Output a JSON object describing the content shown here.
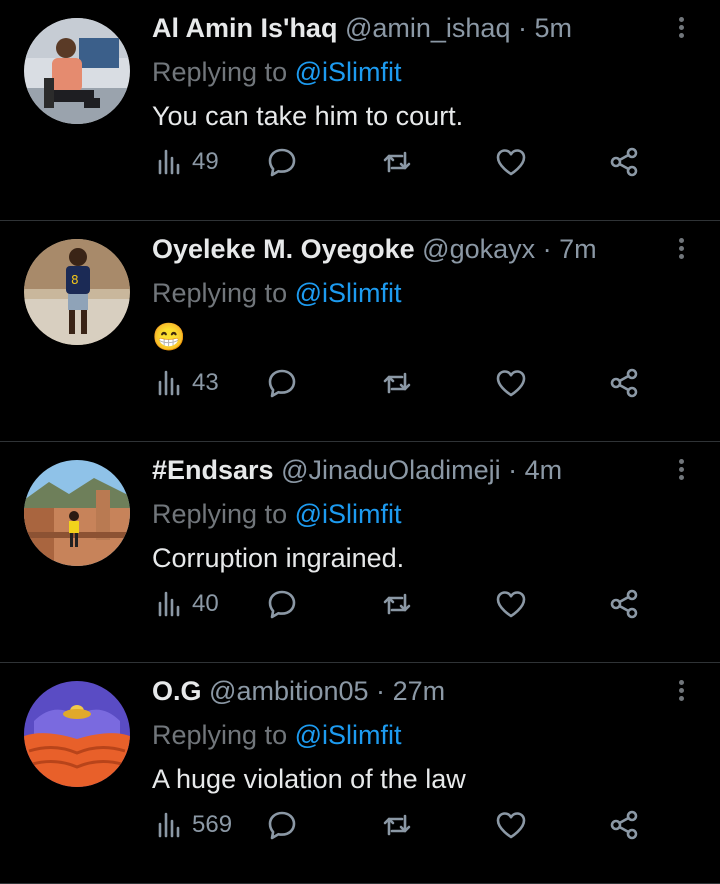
{
  "tweets": [
    {
      "name": "Al Amin Is'haq",
      "handle": "@amin_ishaq",
      "time": "5m",
      "replying_label": "Replying to",
      "mention": "@iSlimfit",
      "text": "You can take him to court.",
      "views": "49"
    },
    {
      "name": "Oyeleke M. Oyegoke",
      "handle": "@gokayx",
      "time": "7m",
      "replying_label": "Replying to",
      "mention": "@iSlimfit",
      "text": "😁",
      "views": "43"
    },
    {
      "name": "#Endsars",
      "handle": "@JinaduOladimeji",
      "time": "4m",
      "replying_label": "Replying to",
      "mention": "@iSlimfit",
      "text": "Corruption ingrained.",
      "views": "40"
    },
    {
      "name": "O.G",
      "handle": "@ambition05",
      "time": "27m",
      "replying_label": "Replying to",
      "mention": "@iSlimfit",
      "text": "A huge violation of the law",
      "views": "569"
    }
  ],
  "separator": "·",
  "icons": {
    "views": "bar-chart-icon",
    "reply": "speech-bubble-icon",
    "retweet": "retweet-icon",
    "like": "heart-icon",
    "share": "share-icon",
    "more": "vertical-ellipsis-icon"
  },
  "colors": {
    "background": "#000000",
    "text": "#e7e9ea",
    "muted": "#71767b",
    "accent": "#1d9bf0",
    "divider": "#2f3336"
  }
}
